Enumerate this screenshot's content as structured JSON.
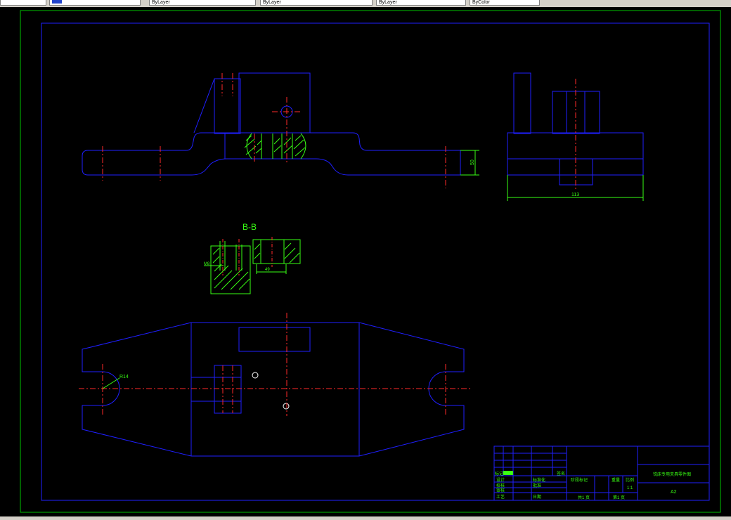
{
  "toolbar": {
    "fields": [
      "",
      "ByLayer",
      "ByLayer",
      "ByLayer",
      "ByColor"
    ]
  },
  "drawing": {
    "section_label": "B-B",
    "dims": {
      "side_height": "50",
      "right_width": "113",
      "radius": "R14",
      "hole": "M8",
      "slot": "49"
    },
    "title_block": {
      "title": "铣床专用夹具零件图",
      "sheet_size": "A2",
      "scale_label": "比例",
      "scale": "1:1",
      "weight_label": "重量",
      "stage_label": "阶段标记",
      "sheet_total": "共1  页",
      "sheet_num": "第1  页",
      "rows": [
        "标记",
        "设计",
        "校核",
        "审核",
        "工艺"
      ],
      "std_label": "标准化",
      "approve_label": "批准",
      "date_label": "日期",
      "signature_label": "签名"
    }
  },
  "colors": {
    "background": "#000000",
    "outline": "#1f1fff",
    "center": "#ff2a2a",
    "hatch": "#39ff14",
    "frame": "#00c000",
    "dim": "#39ff14"
  }
}
